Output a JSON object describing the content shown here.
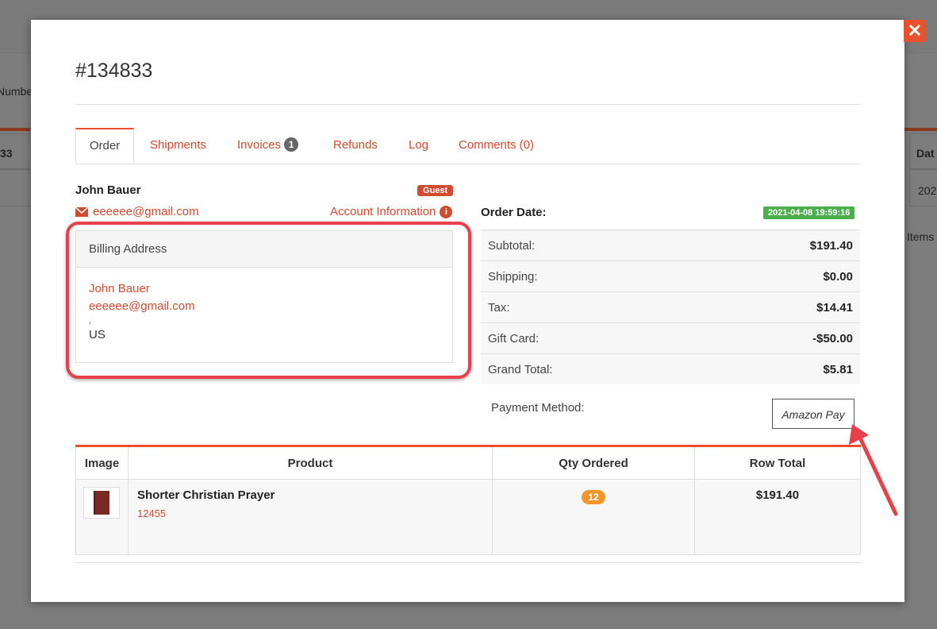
{
  "background": {
    "left_label": "Numbe",
    "left_col_text": "33",
    "right_col_header": "Dat",
    "right_cell": "202",
    "right_items": "Items"
  },
  "modal": {
    "title": "#134833",
    "close_icon": "close-icon",
    "tabs": [
      {
        "label": "Order",
        "active": true
      },
      {
        "label": "Shipments"
      },
      {
        "label": "Invoices",
        "count": "1"
      },
      {
        "label": "Refunds"
      },
      {
        "label": "Log"
      },
      {
        "label": "Comments (0)"
      }
    ]
  },
  "customer": {
    "name": "John Bauer",
    "badge": "Guest",
    "email": "eeeeee@gmail.com",
    "account_link": "Account Information",
    "info_icon": "info-icon"
  },
  "billing": {
    "header": "Billing Address",
    "name": "John Bauer",
    "email": "eeeeee@gmail.com",
    "city_line": ",",
    "country": "US"
  },
  "order": {
    "date_label": "Order Date:",
    "date_value": "2021-04-08 19:59:16",
    "totals": [
      {
        "label": "Subtotal:",
        "value": "$191.40"
      },
      {
        "label": "Shipping:",
        "value": "$0.00"
      },
      {
        "label": "Tax:",
        "value": "$14.41"
      },
      {
        "label": "Gift Card:",
        "value": "-$50.00"
      },
      {
        "label": "Grand Total:",
        "value": "$5.81"
      }
    ],
    "payment_label": "Payment Method:",
    "payment_value": "Amazon Pay"
  },
  "items": {
    "columns": [
      "Image",
      "Product",
      "Qty Ordered",
      "Row Total"
    ],
    "rows": [
      {
        "product": "Shorter Christian Prayer",
        "sku": "12455",
        "qty": "12",
        "row_total": "$191.40"
      }
    ]
  },
  "colors": {
    "accent": "#e8512c",
    "link": "#d04b2f",
    "success": "#4cae4c",
    "qty_badge": "#f0962a",
    "annotation": "#e8404a"
  }
}
